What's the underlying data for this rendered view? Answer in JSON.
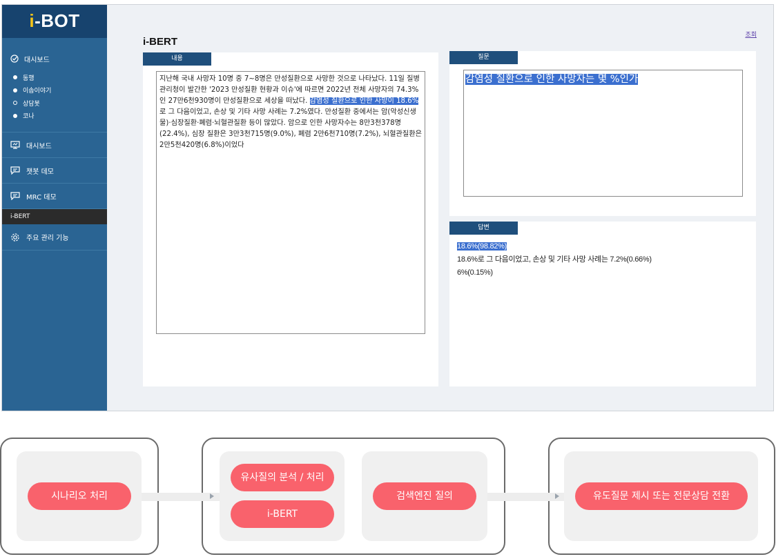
{
  "app": {
    "logo_prefix": "i",
    "logo_suffix": "-BOT",
    "sidebar": {
      "dashboard_group": "대시보드",
      "sub_items": [
        "동행",
        "이솝이야기",
        "상담봇",
        "코나"
      ],
      "nav": [
        "대시보드",
        "챗봇 데모",
        "MRC 데모"
      ],
      "active": "i-BERT",
      "settings": "주요 관리 기능"
    },
    "title": "i-BERT",
    "query_link": "조회",
    "tabs": {
      "content": "내용",
      "question": "질문",
      "answer": "답변"
    },
    "content": {
      "before": "지난해 국내 사망자 10명 중 7~8명은 만성질환으로 사망한 것으로 나타났다. 11일 질병관리청이 발간한 '2023 만성질환 현황과 이슈'에 따르면 2022년 전체 사망자의 74.3%인 27만6천930명이 만성질환으로 세상을 떠났다. ",
      "highlight": "감염성 질환으로 인한 사망이 18.6%",
      "after": "로 그 다음이었고, 손상 및 기타 사망 사례는 7.2%였다. 만성질환 중에서는 암(악성신생물)·심장질환·폐렴·뇌혈관질환 등이 많았다. 암으로 인한 사망자수는 8만3천378명(22.4%), 심장 질환은 3만3천715명(9.0%), 폐렴 2만6천710명(7.2%), 뇌혈관질환은 2만5천420명(6.8%)이었다"
    },
    "question": "감염성 질환으로 인한 사망자는 몇 %인가",
    "answers": [
      "18.6%(98.82%)",
      "18.6%로 그 다음이었고, 손상 및 기타 사망 사례는 7.2%(0.66%)",
      "6%(0.15%)"
    ]
  },
  "flow": {
    "step1": "시나리오 처리",
    "step2a": "유사질의 분석 / 처리",
    "step2b": "i-BERT",
    "step3": "검색엔진 질의",
    "step4": "유도질문 제시 또는 전문상담 전환"
  },
  "colors": {
    "sidebar": "#2a6493",
    "logo_bg": "#17436e",
    "tab": "#1f4f7c",
    "highlight": "#3b6fcf",
    "pill": "#f9626c"
  }
}
